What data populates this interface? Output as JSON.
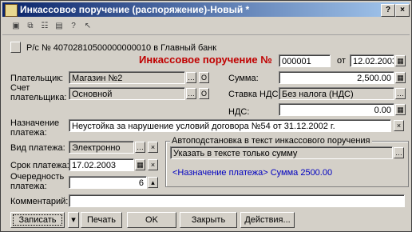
{
  "window": {
    "title": "Инкассовое поручение (распоряжение)-Новый *"
  },
  "account_line": "Р/с № 40702810500000000010 в Главный банк",
  "doc": {
    "title": "Инкассовое поручение №",
    "number": "000001",
    "from_label": "от",
    "date": "12.02.2003"
  },
  "payer": {
    "label": "Плательщик:",
    "value": "Магазин №2"
  },
  "payer_account": {
    "label": "Счет плательщика:",
    "value": "Основной"
  },
  "sum": {
    "label": "Сумма:",
    "value": "2,500.00"
  },
  "vat_rate": {
    "label": "Ставка НДС:",
    "value": "Без налога (НДС)"
  },
  "vat": {
    "label": "НДС:",
    "value": "0.00"
  },
  "purpose": {
    "label": "Назначение платежа:",
    "value": "Неустойка за нарушение условий договора №54 от 31.12.2002 г."
  },
  "payment_type": {
    "label": "Вид платежа:",
    "value": "Электронно"
  },
  "deadline": {
    "label": "Срок платежа:",
    "value": "17.02.2003"
  },
  "priority": {
    "label": "Очередность платежа:",
    "value": "6"
  },
  "autotext": {
    "group_label": "Автоподстановка в текст инкассового поручения",
    "option": "Указать в тексте только сумму",
    "preview": "<Назначение платежа> Сумма 2500.00"
  },
  "comment": {
    "label": "Комментарий:",
    "value": ""
  },
  "buttons": {
    "save": "Записать",
    "print": "Печать",
    "ok": "OK",
    "close": "Закрыть",
    "actions": "Действия..."
  },
  "title_buttons": {
    "help": "?",
    "close": "×"
  }
}
